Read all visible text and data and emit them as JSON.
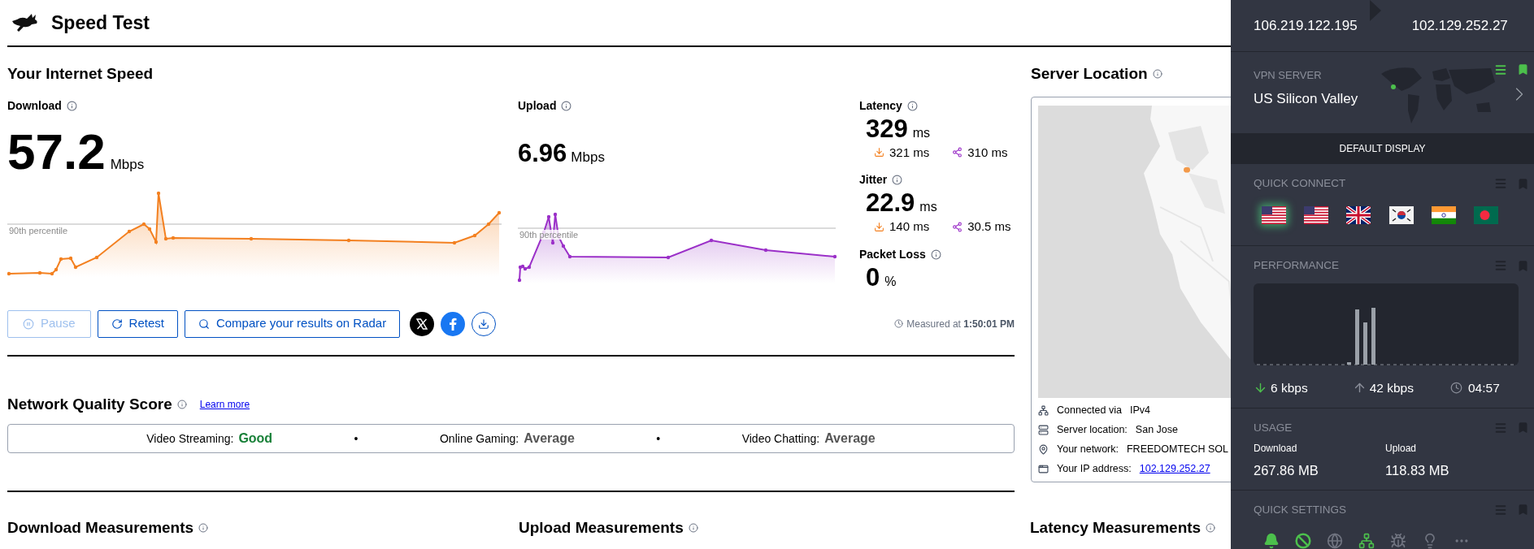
{
  "header": {
    "title": "Speed Test"
  },
  "speed": {
    "title": "Your Internet Speed",
    "download": {
      "label": "Download",
      "value": "57.2",
      "unit": "Mbps",
      "percentile_label": "90th percentile"
    },
    "upload": {
      "label": "Upload",
      "value": "6.96",
      "unit": "Mbps",
      "percentile_label": "90th percentile"
    },
    "latency": {
      "label": "Latency",
      "value": "329",
      "unit": "ms",
      "down": "321 ms",
      "up": "310 ms"
    },
    "jitter": {
      "label": "Jitter",
      "value": "22.9",
      "unit": "ms",
      "down": "140 ms",
      "up": "30.5 ms"
    },
    "packet_loss": {
      "label": "Packet Loss",
      "value": "0",
      "unit": "%"
    },
    "buttons": [
      {
        "kind": "pause",
        "label": "Pause",
        "disabled": true
      },
      {
        "kind": "retest",
        "label": "Retest",
        "disabled": false
      },
      {
        "kind": "search",
        "label": "Compare your results on Radar",
        "disabled": false
      }
    ],
    "share": [
      {
        "kind": "x"
      },
      {
        "kind": "facebook"
      },
      {
        "kind": "download"
      }
    ],
    "measured": {
      "label": "Measured at",
      "time": "1:50:01 PM"
    }
  },
  "server_location": {
    "title": "Server Location",
    "rows": [
      {
        "kind": "network",
        "label": "Connected via",
        "value": "IPv4",
        "link": false
      },
      {
        "kind": "server",
        "label": "Server location:",
        "value": "San Jose",
        "link": false
      },
      {
        "kind": "pin",
        "label": "Your network:",
        "value": "FREEDOMTECH SOL",
        "link": false
      },
      {
        "kind": "window",
        "label": "Your IP address:",
        "value": "102.129.252.27",
        "link": true
      }
    ]
  },
  "network_quality": {
    "title": "Network Quality Score",
    "link": "Learn more",
    "separator": "•",
    "items": [
      {
        "label": "Video Streaming:",
        "value": "Good",
        "color": "#188038"
      },
      {
        "label": "Online Gaming:",
        "value": "Average",
        "color": "#555555"
      },
      {
        "label": "Video Chatting:",
        "value": "Average",
        "color": "#555555"
      }
    ]
  },
  "measurements": [
    "Download Measurements",
    "Upload Measurements",
    "Latency Measurements"
  ],
  "vpn": {
    "ip": "106.219.122.195",
    "vpn_ip": "102.129.252.27",
    "server": {
      "label": "VPN SERVER",
      "name": "US Silicon Valley",
      "pinned": true
    },
    "display_button": "DEFAULT DISPLAY",
    "quick_connect": {
      "title": "QUICK CONNECT",
      "pinned": false,
      "flags": [
        {
          "kind": "us",
          "selected": true
        },
        {
          "kind": "us",
          "selected": false
        },
        {
          "kind": "uk",
          "selected": false
        },
        {
          "kind": "kr",
          "selected": false
        },
        {
          "kind": "in",
          "selected": false
        },
        {
          "kind": "bd",
          "selected": false
        }
      ]
    },
    "performance": {
      "title": "PERFORMANCE",
      "pinned": false,
      "down": "6 kbps",
      "up": "42 kbps",
      "time": "04:57"
    },
    "usage": {
      "title": "USAGE",
      "pinned": false,
      "download_label": "Download",
      "download": "267.86 MB",
      "upload_label": "Upload",
      "upload": "118.83 MB"
    },
    "quick_settings": {
      "title": "QUICK SETTINGS",
      "pinned": false,
      "items": [
        {
          "kind": "bell",
          "on": true
        },
        {
          "kind": "shield",
          "on": true
        },
        {
          "kind": "globe",
          "on": false
        },
        {
          "kind": "network",
          "on": true
        },
        {
          "kind": "bug",
          "on": false
        },
        {
          "kind": "bulb",
          "on": false
        },
        {
          "kind": "more",
          "on": false
        }
      ]
    }
  }
}
